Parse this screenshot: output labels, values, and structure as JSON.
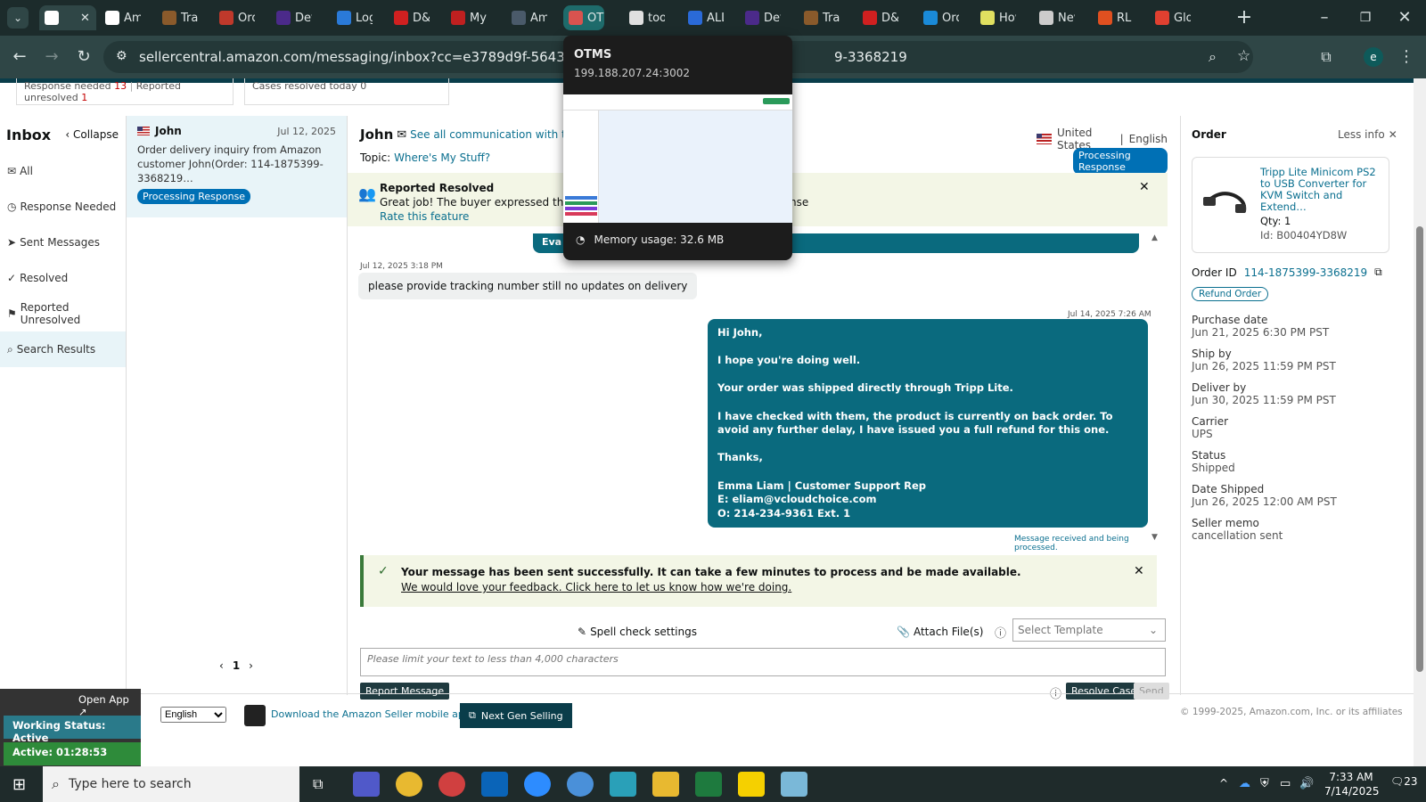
{
  "browser": {
    "tabs": [
      {
        "label": "",
        "icon": "amazon-icon",
        "color": "#ffffff"
      },
      {
        "label": "Am",
        "icon": "amazon-icon",
        "color": "#ffffff"
      },
      {
        "label": "Trac",
        "icon": "ups-icon",
        "color": "#8a5a2b"
      },
      {
        "label": "Ord",
        "icon": "order-icon",
        "color": "#c0392b"
      },
      {
        "label": "Det",
        "icon": "fedex-icon",
        "color": "#4b2a8a"
      },
      {
        "label": "Log",
        "icon": "log-icon",
        "color": "#2a7ad8"
      },
      {
        "label": "D&",
        "icon": "dh-icon",
        "color": "#d02020"
      },
      {
        "label": "My",
        "icon": "my-icon",
        "color": "#c02020"
      },
      {
        "label": "Am",
        "icon": "amazon-icon",
        "color": "#4a5a6a"
      },
      {
        "label": "OT",
        "icon": "otms-icon",
        "color": "#d9534f"
      },
      {
        "label": "too",
        "icon": "tool-icon",
        "color": "#e0e0e0"
      },
      {
        "label": "ALL",
        "icon": "seventeen-icon",
        "color": "#2a6ad8"
      },
      {
        "label": "Det",
        "icon": "fedex-icon",
        "color": "#4b2a8a"
      },
      {
        "label": "Trac",
        "icon": "ups-icon",
        "color": "#8a5a2b"
      },
      {
        "label": "D&",
        "icon": "dh-icon",
        "color": "#d02020"
      },
      {
        "label": "Ord",
        "icon": "ec-icon",
        "color": "#1a8ad8"
      },
      {
        "label": "Hov",
        "icon": "hov-icon",
        "color": "#e0e060"
      },
      {
        "label": "Nev",
        "icon": "chrome-icon",
        "color": "#cccccc"
      },
      {
        "label": "RL C",
        "icon": "rl-icon",
        "color": "#e05020"
      },
      {
        "label": "Glo",
        "icon": "glo-icon",
        "color": "#e04030"
      }
    ],
    "url_main": "sellercentral.amazon.com/messaging/inbox?cc=e3789d9f-5643-47ec-9702-5",
    "url_tail": "9-3368219",
    "profile_initial": "e"
  },
  "stats": {
    "response_needed_label": "Response needed",
    "response_needed_count": "13",
    "reported_unresolved_label": "Reported unresolved",
    "reported_unresolved_count": "1",
    "cases_resolved_label": "Cases resolved today",
    "cases_resolved_count": "0"
  },
  "inbox": {
    "title": "Inbox",
    "collapse": "Collapse",
    "items": [
      "All",
      "Response Needed",
      "Sent Messages",
      "Resolved",
      "Reported Unresolved",
      "Search Results"
    ]
  },
  "conversation_item": {
    "name": "John",
    "date": "Jul 12, 2025",
    "preview": "Order delivery inquiry from Amazon customer John(Order: 114-1875399-3368219…",
    "badge": "Processing Response"
  },
  "pager": {
    "page": "1"
  },
  "header": {
    "name": "John",
    "see_all": "See all communication with this b",
    "topic_label": "Topic:",
    "topic": "Where's My Stuff?",
    "country": "United States",
    "language": "English",
    "status_badge": "Processing Response"
  },
  "reported_banner": {
    "title": "Reported Resolved",
    "text": "Great job! The buyer expressed that you",
    "text_tail": "nse",
    "rate": "Rate this feature"
  },
  "messages": {
    "eva_label": "Eva .",
    "incoming_time": "Jul 12, 2025 3:18 PM",
    "incoming_text": "please provide tracking number still no updates on delivery",
    "outgoing_time": "Jul 14, 2025 7:26 AM",
    "outgoing_lines": [
      "Hi John,",
      "",
      "I hope you're doing well.",
      "",
      "Your order was shipped directly through Tripp Lite.",
      "",
      "I have checked with them, the product is currently on back order. To avoid any further delay, I have issued you a full refund for this one.",
      "",
      "Thanks,",
      "",
      "Emma Liam | Customer Support Rep",
      " E: eliam@vcloudchoice.com",
      "O: 214-234-9361 Ext. 1"
    ],
    "outgoing_status": "Message received and being processed."
  },
  "success_banner": {
    "text": "Your message has been sent successfully. It can take a few minutes to process and be made available.",
    "feedback": "We would love your feedback. Click here to let us know how we're doing."
  },
  "composer": {
    "spell_check": "Spell check settings",
    "attach": "Attach File(s)",
    "template_placeholder": "Select Template",
    "textarea_placeholder": "Please limit your text to less than 4,000 characters",
    "report": "Report Message",
    "resolve": "Resolve Case",
    "send": "Send"
  },
  "order": {
    "title": "Order",
    "less_info": "Less info",
    "product_name": "Tripp Lite Minicom PS2 to USB Converter for KVM Switch and Extend…",
    "qty": "Qty: 1",
    "id": "Id: B00404YD8W",
    "order_id_label": "Order ID",
    "order_id": "114-1875399-3368219",
    "refund": "Refund Order",
    "fields": [
      {
        "label": "Purchase date",
        "value": "Jun 21, 2025 6:30 PM PST"
      },
      {
        "label": "Ship by",
        "value": "Jun 26, 2025 11:59 PM PST"
      },
      {
        "label": "Deliver by",
        "value": "Jun 30, 2025 11:59 PM PST"
      },
      {
        "label": "Carrier",
        "value": "UPS"
      },
      {
        "label": "Status",
        "value": "Shipped"
      },
      {
        "label": "Date Shipped",
        "value": "Jun 26, 2025 12:00 AM PST"
      },
      {
        "label": "Seller memo",
        "value": "cancellation sent"
      }
    ]
  },
  "footer": {
    "open_app": "Open App ↗",
    "working_status": "Working Status: Active",
    "active_timer": "Active: 01:28:53",
    "language": "English",
    "download": "Download the Amazon Seller mobile app",
    "next_gen": "Next Gen Selling",
    "copyright": "© 1999-2025, Amazon.com, Inc. or its affiliates"
  },
  "tooltip": {
    "title": "OTMS",
    "address": "199.188.207.24:3002",
    "memory": "Memory usage: 32.6 MB"
  },
  "taskbar": {
    "search_placeholder": "Type here to search",
    "time": "7:33 AM",
    "date": "7/14/2025",
    "notifications": "23"
  }
}
